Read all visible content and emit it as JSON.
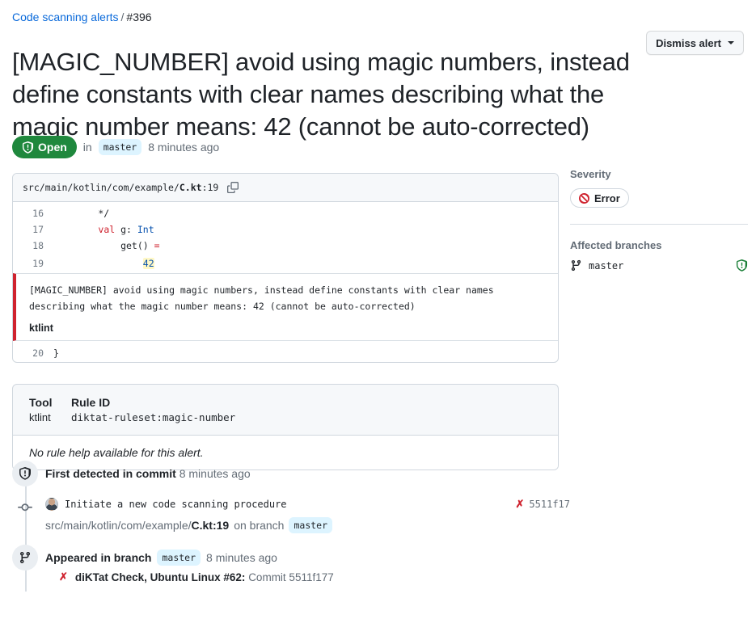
{
  "breadcrumb": {
    "link_label": "Code scanning alerts",
    "separator": "/",
    "number": "#396"
  },
  "header": {
    "title": "[MAGIC_NUMBER] avoid using magic numbers, instead define constants with clear names describing what the magic number means: 42 (cannot be auto-corrected)",
    "dismiss_label": "Dismiss alert"
  },
  "state": {
    "badge_label": "Open",
    "in_label": "in",
    "branch": "master",
    "time": "8 minutes ago"
  },
  "code": {
    "path_prefix": "src/main/kotlin/com/example/",
    "path_file": "C.kt",
    "path_line": ":19",
    "lines": [
      {
        "num": "16",
        "text": "        */"
      },
      {
        "num": "17",
        "text": "        val g: Int"
      },
      {
        "num": "18",
        "text": "            get() ="
      },
      {
        "num": "19",
        "text": "                42"
      }
    ],
    "trailing_line": {
      "num": "20",
      "text": "}"
    }
  },
  "alert_message": {
    "text": "[MAGIC_NUMBER] avoid using magic numbers, instead define constants with clear names describing what the magic number means: 42 (cannot be auto-corrected)",
    "tool": "ktlint"
  },
  "rule_card": {
    "tool_header": "Tool",
    "tool_value": "ktlint",
    "rule_header": "Rule ID",
    "rule_value": "diktat-ruleset:magic-number",
    "no_help_text": "No rule help available for this alert."
  },
  "timeline": {
    "first_detected": {
      "label": "First detected in commit",
      "time": "8 minutes ago"
    },
    "commit": {
      "message": "Initiate a new code scanning procedure",
      "sha": "5511f17",
      "path_prefix": "src/main/kotlin/com/example/",
      "path_file": "C.kt:19",
      "on_branch_label": "on branch",
      "branch": "master"
    },
    "appeared": {
      "label": "Appeared in branch",
      "branch": "master",
      "time": "8 minutes ago"
    },
    "check": {
      "name": "diKTat Check, Ubuntu Linux #62:",
      "commit_label": "Commit 5511f177"
    }
  },
  "sidebar": {
    "severity_header": "Severity",
    "severity_value": "Error",
    "branches_header": "Affected branches",
    "branch_name": "master"
  },
  "colors": {
    "link": "#0969da",
    "open_green": "#1f883d",
    "error_red": "#cf222e",
    "muted": "#636c76"
  }
}
